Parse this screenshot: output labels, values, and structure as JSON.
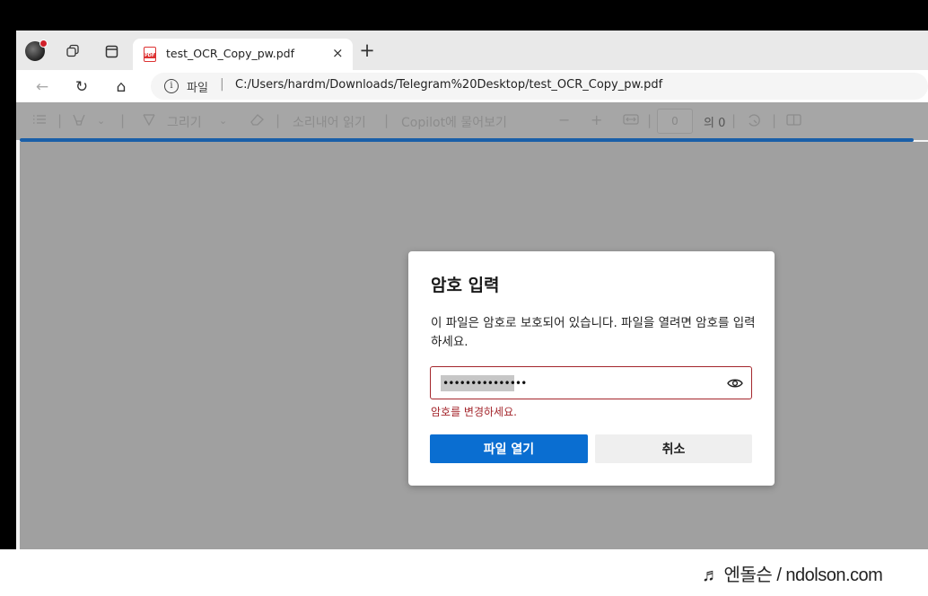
{
  "tab": {
    "title": "test_OCR_Copy_pw.pdf",
    "close": "×",
    "new_tab": "+"
  },
  "address": {
    "scheme": "파일",
    "separator": "|",
    "url": "C:/Users/hardm/Downloads/Telegram%20Desktop/test_OCR_Copy_pw.pdf"
  },
  "nav": {
    "back": "←",
    "refresh": "↻",
    "home": "⌂"
  },
  "pdf_toolbar": {
    "draw_label": "그리기",
    "read_aloud_label": "소리내어 읽기",
    "copilot_label": "Copilot에 물어보기",
    "zoom_out": "−",
    "zoom_in": "+",
    "page_value": "0",
    "page_total": "의 0"
  },
  "dialog": {
    "title": "암호 입력",
    "message": "이 파일은 암호로 보호되어 있습니다. 파일을 열려면 암호를 입력하세요.",
    "password_value": "•••••••••••••••",
    "error": "암호를 변경하세요.",
    "open_button": "파일 열기",
    "cancel_button": "취소"
  },
  "watermark": {
    "text": "♬ 엔돌슨 / ndolson.com"
  },
  "colors": {
    "accent": "#0a6ed1",
    "error": "#a4262c",
    "progress": "#1a5fa8"
  }
}
